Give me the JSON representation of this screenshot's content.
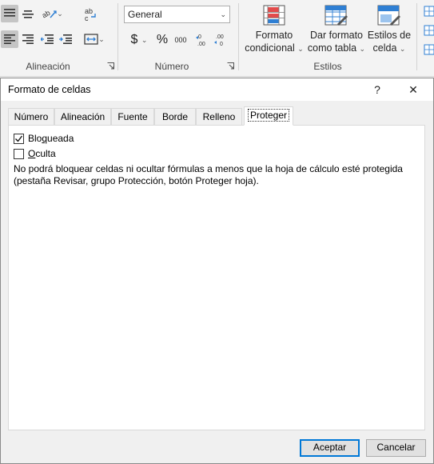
{
  "ribbon": {
    "alignment_group_label": "Alineación",
    "number_group_label": "Número",
    "styles_group_label": "Estilos",
    "number_format_value": "General",
    "currency_symbol": "$",
    "percent_symbol": "%",
    "thousands_symbol": "000",
    "increase_decimals_label": "←0 .00",
    "decrease_decimals_label": ".00 →0",
    "conditional_format": {
      "line1": "Formato",
      "line2": "condicional"
    },
    "format_as_table": {
      "line1": "Dar formato",
      "line2": "como tabla"
    },
    "cell_styles": {
      "line1": "Estilos de",
      "line2": "celda"
    },
    "colors": {
      "accent_red": "#e24b4b",
      "accent_blue": "#2f7fd3"
    }
  },
  "dialog": {
    "title": "Formato de celdas",
    "help_label": "?",
    "close_label": "✕",
    "tabs": [
      {
        "label": "Número",
        "active": false
      },
      {
        "label": "Alineación",
        "active": false
      },
      {
        "label": "Fuente",
        "active": false
      },
      {
        "label": "Borde",
        "active": false
      },
      {
        "label": "Relleno",
        "active": false
      },
      {
        "label": "Proteger",
        "active": true
      }
    ],
    "locked": {
      "label_pre": "Blo",
      "label_mnemonic": "q",
      "label_post": "ueada",
      "checked": true
    },
    "hidden": {
      "label_pre": "",
      "label_mnemonic": "O",
      "label_post": "culta",
      "checked": false
    },
    "note_line1": "No podrá bloquear celdas ni ocultar fórmulas a menos que la hoja de cálculo esté protegida",
    "note_line2": "(pestaña Revisar, grupo Protección, botón Proteger hoja).",
    "ok_label": "Aceptar",
    "cancel_label": "Cancelar",
    "colors": {
      "primary_border": "#0078d7"
    }
  }
}
